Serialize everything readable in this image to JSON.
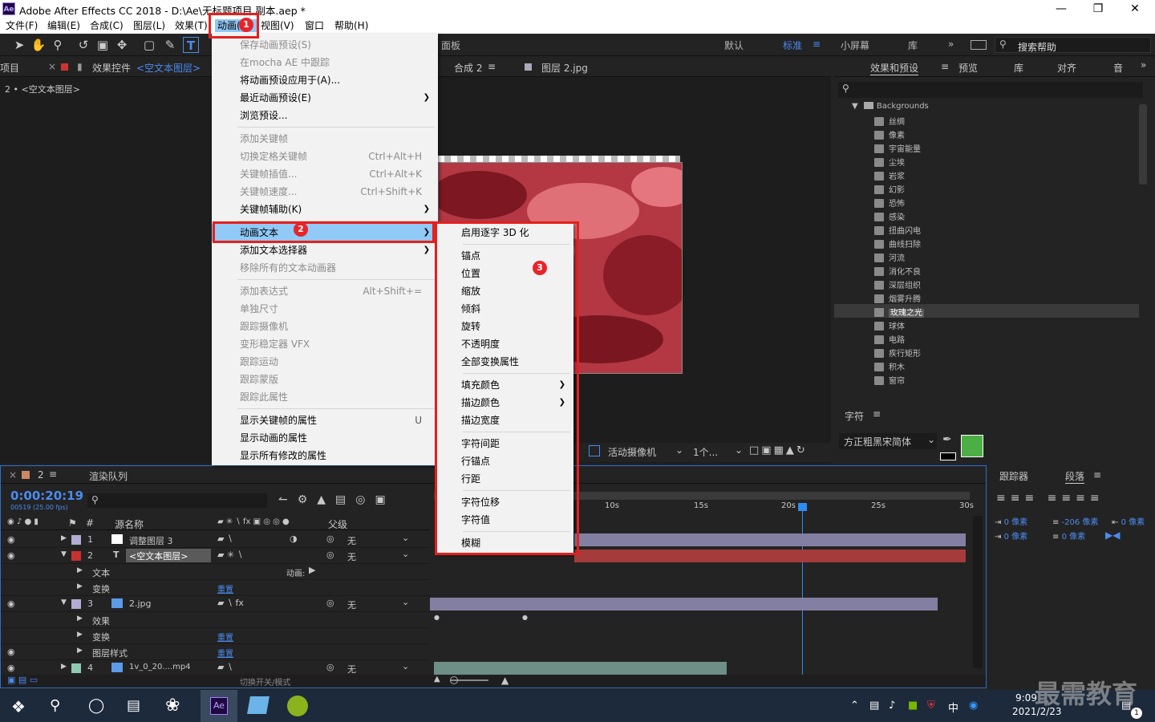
{
  "title": "Adobe After Effects CC 2018 - D:\\Ae\\无标题项目 副本.aep *",
  "menubar": [
    "文件(F)",
    "编辑(E)",
    "合成(C)",
    "图层(L)",
    "效果(T)",
    "动画(A)",
    "视图(V)",
    "窗口",
    "帮助(H)"
  ],
  "workspaces": {
    "panel": "面板",
    "default": "默认",
    "standard": "标准",
    "small": "小屏幕",
    "library": "库",
    "search": "搜索帮助"
  },
  "left_panel": {
    "project_tab": "项目",
    "effects_tab": "效果控件",
    "effects_layer": "<空文本图层>",
    "sub": "2 • <空文本图层>"
  },
  "comp_panel": {
    "tab1": "合成 2",
    "tab2": "图层 2.jpg",
    "camera": "活动摄像机",
    "views": "1个..."
  },
  "effects_panel": {
    "tabs": [
      "效果和预设",
      "预览",
      "库",
      "对齐",
      "音"
    ],
    "folder": "Backgrounds",
    "items": [
      "丝绸",
      "像素",
      "宇宙能量",
      "尘埃",
      "岩浆",
      "幻影",
      "恐怖",
      "感染",
      "扭曲闪电",
      "曲线扫除",
      "河流",
      "消化不良",
      "深层组织",
      "烟雾升腾",
      "玫瑰之光",
      "球体",
      "电路",
      "疾行矩形",
      "积木",
      "窗帘"
    ],
    "selected": "玫瑰之光"
  },
  "char_panel": {
    "title": "字符",
    "font": "方正粗黑宋简体"
  },
  "timeline": {
    "tab": "2",
    "render_tab": "渲染队列",
    "time": "0:00:20:19",
    "frames": "00519 (25.00 fps)",
    "col_name": "源名称",
    "col_parent": "父级",
    "ticks": [
      "10s",
      "15s",
      "20s",
      "25s",
      "30s"
    ],
    "footer": "切换开关/模式",
    "anim_label": "动画:",
    "reset": "重置",
    "layers": [
      {
        "num": "1",
        "name": "调整图层 3",
        "parent": "无"
      },
      {
        "num": "2",
        "name": "<空文本图层>",
        "parent": "无"
      },
      {
        "num": "3",
        "name": "2.jpg",
        "parent": "无"
      },
      {
        "num": "4",
        "name": "1v_0_20....mp4",
        "parent": "无"
      }
    ],
    "props": {
      "text": "文本",
      "transform": "变换",
      "effects": "效果",
      "layer_style": "图层样式"
    }
  },
  "para_panel": {
    "tabs": [
      "跟踪器",
      "段落"
    ],
    "px1": "0 像素",
    "px2": "-206 像素",
    "px3": "0 像素",
    "px4": "0 像素",
    "px5": "0 像素"
  },
  "anim_menu": [
    {
      "label": "保存动画预设(S)",
      "dis": true
    },
    {
      "label": "在mocha AE 中跟踪",
      "dis": true
    },
    {
      "label": "将动画预设应用于(A)..."
    },
    {
      "label": "最近动画预设(E)",
      "arrow": true
    },
    {
      "label": "浏览预设..."
    },
    {
      "label": "添加关键帧",
      "dis": true,
      "sep": true
    },
    {
      "label": "切换定格关键帧",
      "sc": "Ctrl+Alt+H",
      "dis": true
    },
    {
      "label": "关键帧插值...",
      "sc": "Ctrl+Alt+K",
      "dis": true
    },
    {
      "label": "关键帧速度...",
      "sc": "Ctrl+Shift+K",
      "dis": true
    },
    {
      "label": "关键帧辅助(K)",
      "arrow": true
    },
    {
      "label": "动画文本",
      "arrow": true,
      "sep": true,
      "hl": true
    },
    {
      "label": "添加文本选择器",
      "arrow": true
    },
    {
      "label": "移除所有的文本动画器",
      "dis": true
    },
    {
      "label": "添加表达式",
      "sc": "Alt+Shift+=",
      "dis": true,
      "sep": true
    },
    {
      "label": "单独尺寸",
      "dis": true
    },
    {
      "label": "跟踪摄像机",
      "dis": true
    },
    {
      "label": "变形稳定器 VFX",
      "dis": true
    },
    {
      "label": "跟踪运动",
      "dis": true
    },
    {
      "label": "跟踪蒙版",
      "dis": true
    },
    {
      "label": "跟踪此属性",
      "dis": true
    },
    {
      "label": "显示关键帧的属性",
      "sc": "U",
      "sep": true
    },
    {
      "label": "显示动画的属性"
    },
    {
      "label": "显示所有修改的属性"
    }
  ],
  "sub_menu": [
    {
      "label": "启用逐字 3D 化"
    },
    {
      "label": "锚点",
      "sep": true
    },
    {
      "label": "位置"
    },
    {
      "label": "缩放"
    },
    {
      "label": "倾斜"
    },
    {
      "label": "旋转"
    },
    {
      "label": "不透明度"
    },
    {
      "label": "全部变换属性"
    },
    {
      "label": "填充颜色",
      "arrow": true,
      "sep": true
    },
    {
      "label": "描边颜色",
      "arrow": true
    },
    {
      "label": "描边宽度"
    },
    {
      "label": "字符间距",
      "sep": true
    },
    {
      "label": "行锚点"
    },
    {
      "label": "行距"
    },
    {
      "label": "字符位移",
      "sep": true
    },
    {
      "label": "字符值"
    },
    {
      "label": "模糊",
      "sep": true
    }
  ],
  "badges": [
    "1",
    "2",
    "3"
  ],
  "taskbar": {
    "time": "9:09",
    "date": "2021/2/23",
    "ime": "中",
    "notif": "1"
  },
  "watermark": "最需教育",
  "colors": {
    "accent": "#2d8cf0",
    "highlight": "#91c9f7",
    "red": "#e5201e"
  }
}
